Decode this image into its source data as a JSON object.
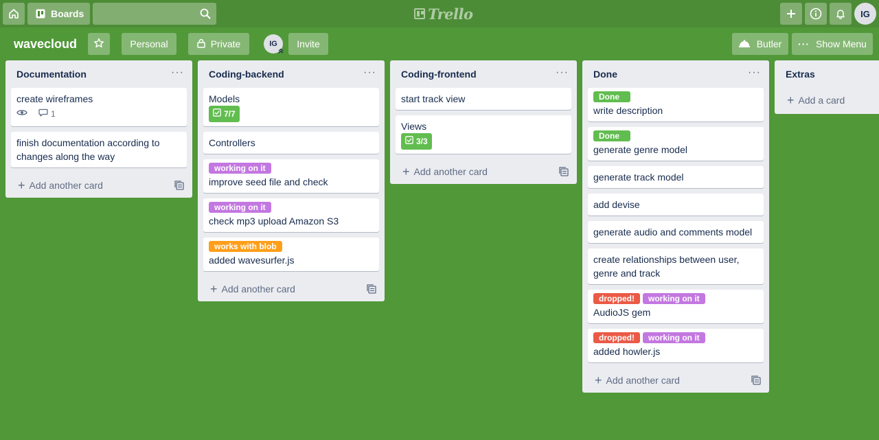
{
  "header": {
    "boards_label": "Boards",
    "search_placeholder": "",
    "logo_text": "Trello",
    "user_initials": "IG"
  },
  "board": {
    "name": "wavecloud",
    "team_label": "Personal",
    "visibility_label": "Private",
    "member_initials": "IG",
    "invite_label": "Invite",
    "butler_label": "Butler",
    "show_menu_label": "Show Menu"
  },
  "colors": {
    "board_bg": "#519839",
    "header_bg": "#4c8c36",
    "label_green": "#61bd4f",
    "label_purple": "#c377e0",
    "label_orange": "#ff9f1a",
    "label_red": "#eb5a46"
  },
  "add_card_label": "Add another card",
  "lists": [
    {
      "title": "Documentation",
      "cards": [
        {
          "title": "create wireframes",
          "watching": true,
          "comments": "1"
        },
        {
          "title": "finish documentation according to changes along the way"
        }
      ]
    },
    {
      "title": "Coding-backend",
      "cards": [
        {
          "title": "Models",
          "checklist": "7/7"
        },
        {
          "title": "Controllers"
        },
        {
          "title": "improve seed file and check",
          "labels": [
            {
              "text": "working on it",
              "color": "purple"
            }
          ]
        },
        {
          "title": "check mp3 upload Amazon S3",
          "labels": [
            {
              "text": "working on it",
              "color": "purple"
            }
          ]
        },
        {
          "title": "added wavesurfer.js",
          "labels": [
            {
              "text": "works with blob",
              "color": "orange"
            }
          ]
        }
      ]
    },
    {
      "title": "Coding-frontend",
      "cards": [
        {
          "title": "start track view"
        },
        {
          "title": "Views",
          "checklist": "3/3"
        }
      ]
    },
    {
      "title": "Done",
      "cards": [
        {
          "title": "write description",
          "labels": [
            {
              "text": "Done",
              "color": "green"
            }
          ]
        },
        {
          "title": "generate genre model",
          "labels": [
            {
              "text": "Done",
              "color": "green"
            }
          ]
        },
        {
          "title": "generate track model"
        },
        {
          "title": "add devise"
        },
        {
          "title": "generate audio and comments model"
        },
        {
          "title": "create relationships between user, genre and track"
        },
        {
          "title": "AudioJS gem",
          "labels": [
            {
              "text": "dropped!",
              "color": "red"
            },
            {
              "text": "working on it",
              "color": "purple"
            }
          ]
        },
        {
          "title": "added howler.js",
          "labels": [
            {
              "text": "dropped!",
              "color": "red"
            },
            {
              "text": "working on it",
              "color": "purple"
            }
          ]
        }
      ]
    },
    {
      "title": "Extras",
      "add_label": "Add a card"
    }
  ]
}
